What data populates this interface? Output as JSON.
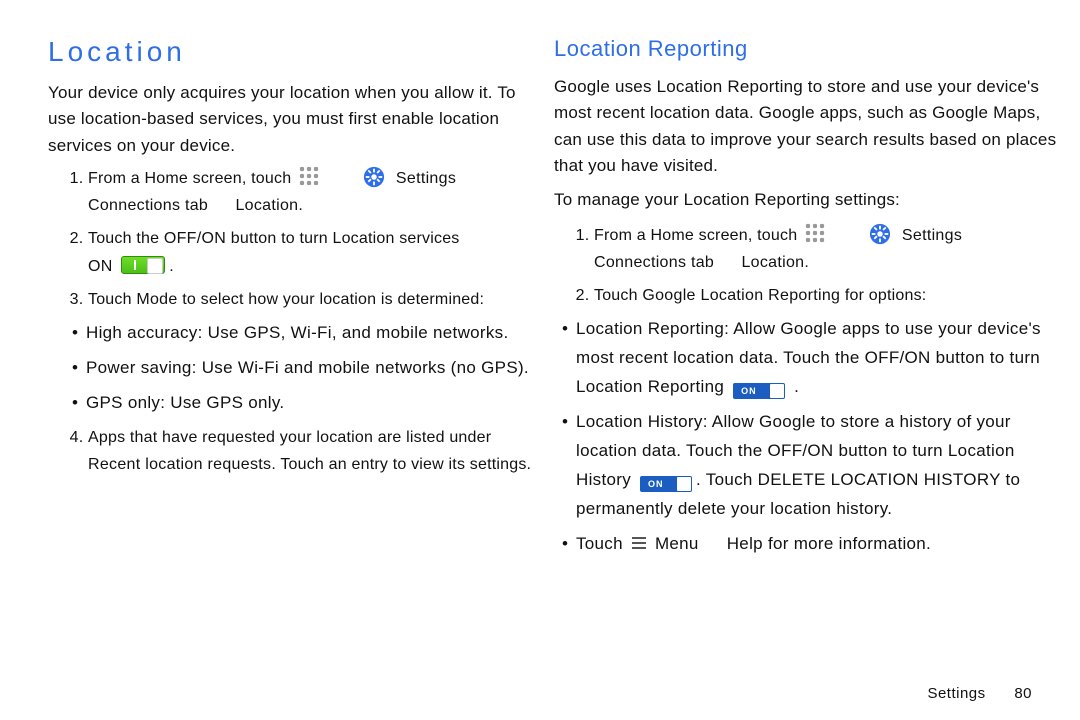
{
  "left": {
    "heading": "Location",
    "intro": "Your device only acquires your location when you allow it. To use location-based services, you must first enable location services on your device.",
    "step1_a": "From a Home screen, touch",
    "settings_label": "Settings",
    "step1_b": "Connections tab",
    "step1_c": "Location.",
    "step2_a": "Touch the",
    "step2_offon": "OFF/ON",
    "step2_b": "button to turn Location services",
    "step2_on": "ON",
    "step3_a": "Touch",
    "step3_mode": "Mode",
    "step3_b": "to select how your location is determined:",
    "bullets": {
      "b1_label": "High accuracy",
      "b1_text": ": Use GPS, Wi-Fi, and mobile networks.",
      "b2_label": "Power saving",
      "b2_text": ": Use Wi-Fi and mobile networks (no GPS).",
      "b3_label": "GPS only",
      "b3_text": ": Use GPS only."
    },
    "step4_a": "Apps that have requested your location are listed under",
    "step4_label": "Recent location requests",
    "step4_b": ". Touch an entry to view its settings."
  },
  "right": {
    "heading": "Location Reporting",
    "intro": "Google uses Location Reporting to store and use your device's most recent location data. Google apps, such as Google Maps, can use this data to improve your search results based on places that you have visited.",
    "lead": "To manage your Location Reporting settings:",
    "step1_a": "From a Home screen, touch",
    "settings_label": "Settings",
    "step1_b": "Connections tab",
    "step1_c": "Location.",
    "step2_a": "Touch",
    "step2_label": "Google Location Reporting",
    "step2_b": "for options:",
    "bullets": {
      "b1_label": "Location Reporting",
      "b1_text_a": ": Allow Google apps to use your device's most recent location data. Touch the OFF/ON button to turn Location Reporting",
      "b1_on": "ON",
      "b1_period": ".",
      "b2_label": "Location History",
      "b2_text_a": ": Allow Google to store a history of your location data. Touch the OFF/ON button to turn Location History",
      "b2_on": "ON",
      "b2_text_b": ". Touch",
      "b2_delete": "DELETE LOCATION HISTORY",
      "b2_text_c": "to permanently delete your location history.",
      "b3_a": "Touch",
      "b3_menu": "Menu",
      "b3_help": "Help",
      "b3_b": "for more information."
    }
  },
  "footer": {
    "section": "Settings",
    "page": "80"
  },
  "toggle_on_text": "ON"
}
